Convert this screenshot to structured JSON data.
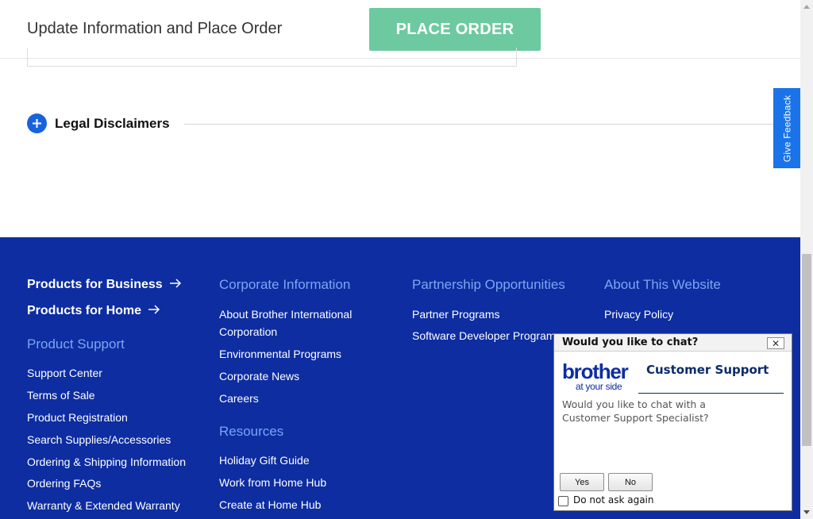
{
  "header": {
    "title": "Update Information and Place Order",
    "place_order_label": "PLACE ORDER",
    "place_order_color": "#6dc9a0"
  },
  "legal": {
    "label": "Legal Disclaimers",
    "expand_icon": "plus-circle-icon"
  },
  "feedback": {
    "label": "Give Feedback",
    "color": "#1a73e8"
  },
  "footer": {
    "background": "#0d2da1",
    "heading_color": "#7aa7f0",
    "business_link": "Products for Business",
    "home_link": "Products for Home",
    "arrow_icon": "arrow-right-icon",
    "product_support": {
      "heading": "Product Support",
      "links": [
        "Support Center",
        "Terms of Sale",
        "Product Registration",
        "Search Supplies/Accessories",
        "Ordering & Shipping Information",
        "Ordering FAQs",
        "Warranty & Extended Warranty"
      ]
    },
    "corporate": {
      "heading": "Corporate Information",
      "links": [
        "About Brother International",
        "Corporation",
        "Environmental Programs",
        "Corporate News",
        "Careers"
      ]
    },
    "resources": {
      "heading": "Resources",
      "links": [
        "Holiday Gift Guide",
        "Work from Home Hub",
        "Create at Home Hub"
      ]
    },
    "partnership": {
      "heading": "Partnership Opportunities",
      "links": [
        "Partner Programs",
        "Software Developer Program"
      ]
    },
    "about_site": {
      "heading": "About This Website",
      "links": [
        "Privacy Policy"
      ]
    }
  },
  "chat": {
    "title": "Would you like to chat?",
    "close_label": "✕",
    "brand_word": "brother",
    "brand_tagline": "at your side",
    "support_title": "Customer Support",
    "message": "Would you like to chat with a Customer Support Specialist?",
    "yes_label": "Yes",
    "no_label": "No",
    "dont_ask_label": "Do not ask again",
    "dont_ask_checked": false
  }
}
